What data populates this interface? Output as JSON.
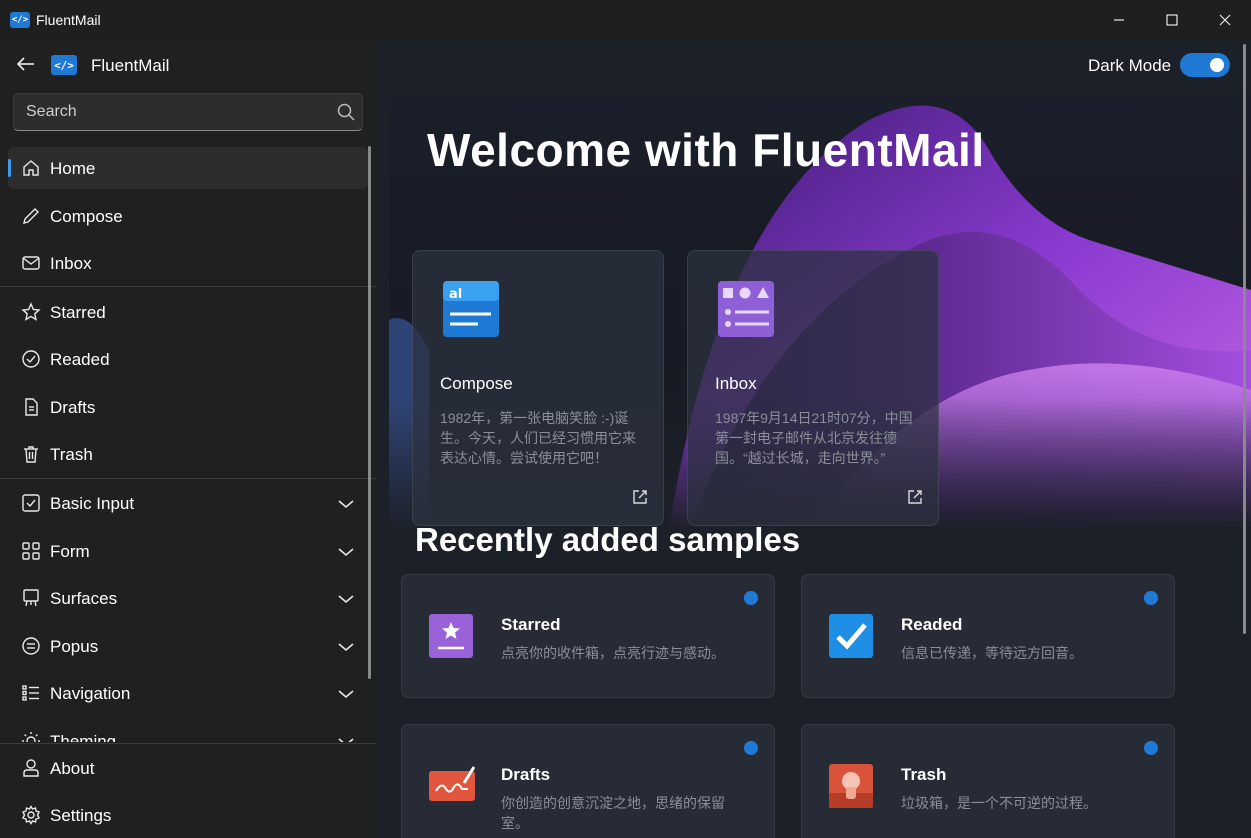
{
  "window": {
    "title": "FluentMail",
    "badge": "</>"
  },
  "nav_header": {
    "app_name": "FluentMail",
    "badge": "</>"
  },
  "search": {
    "placeholder": "Search",
    "value": ""
  },
  "nav": {
    "items": [
      {
        "label": "Home",
        "icon": "home-icon"
      },
      {
        "label": "Compose",
        "icon": "pencil-icon"
      },
      {
        "label": "Inbox",
        "icon": "mail-icon"
      },
      {
        "label": "Starred",
        "icon": "star-icon"
      },
      {
        "label": "Readed",
        "icon": "check-circle-icon"
      },
      {
        "label": "Drafts",
        "icon": "document-icon"
      },
      {
        "label": "Trash",
        "icon": "trash-icon"
      },
      {
        "label": "Basic Input",
        "icon": "checkbox-icon"
      },
      {
        "label": "Form",
        "icon": "grid-icon"
      },
      {
        "label": "Surfaces",
        "icon": "easel-icon"
      },
      {
        "label": "Popus",
        "icon": "list-circle-icon"
      },
      {
        "label": "Navigation",
        "icon": "list-bullets-icon"
      },
      {
        "label": "Theming",
        "icon": "sun-icon"
      }
    ],
    "footer": [
      {
        "label": "About",
        "icon": "person-icon"
      },
      {
        "label": "Settings",
        "icon": "gear-icon"
      }
    ]
  },
  "dark_mode": {
    "label": "Dark Mode",
    "on": true
  },
  "hero": {
    "title": "Welcome with FluentMail",
    "cards": [
      {
        "title": "Compose",
        "desc": "1982年，第一张电脑笑脸 :-)诞生。今天，人们已经习惯用它来表达心情。尝试使用它吧！",
        "icon": "compose-app-icon"
      },
      {
        "title": "Inbox",
        "desc": "1987年9月14日21时07分，中国第一封电子邮件从北京发往德国。“越过长城，走向世界。”",
        "icon": "inbox-app-icon"
      }
    ]
  },
  "samples": {
    "title": "Recently added samples",
    "items": [
      {
        "title": "Starred",
        "desc": "点亮你的收件箱，点亮行迹与感动。",
        "icon": "starred-app-icon"
      },
      {
        "title": "Readed",
        "desc": "信息已传递，等待远方回音。",
        "icon": "readed-app-icon"
      },
      {
        "title": "Drafts",
        "desc": "你创造的创意沉淀之地，思绪的保留室。",
        "icon": "drafts-app-icon"
      },
      {
        "title": "Trash",
        "desc": "垃圾箱，是一个不可逆的过程。",
        "icon": "trash-app-icon"
      }
    ]
  },
  "colors": {
    "accent": "#1f7ad6",
    "background": "#1c2028",
    "sidebar": "#202020"
  }
}
